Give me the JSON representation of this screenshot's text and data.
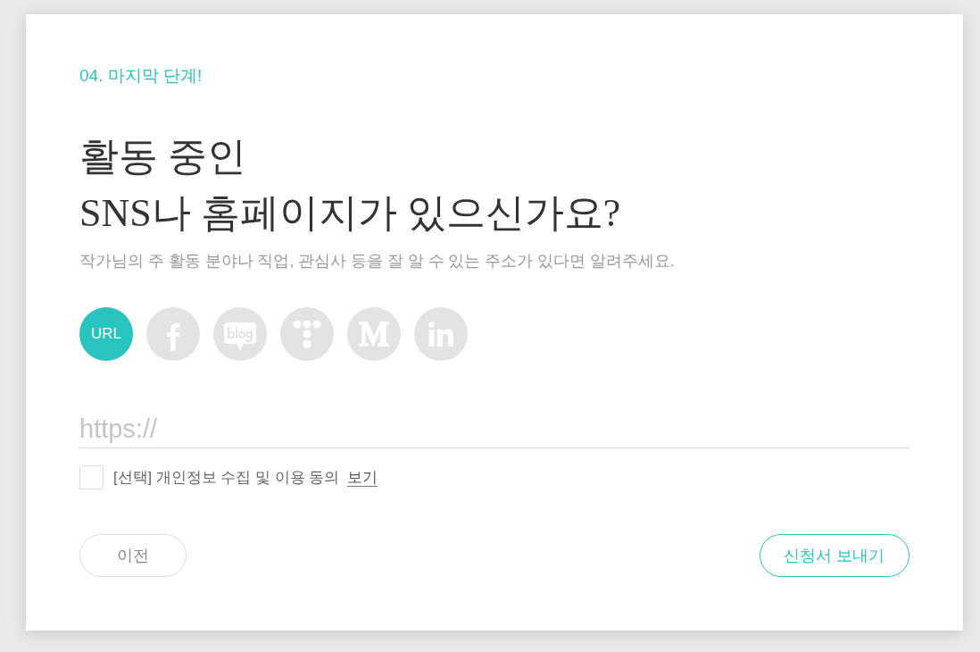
{
  "step_label": "04. 마지막 단계!",
  "title": "활동 중인\nSNS나 홈페이지가 있으신가요?",
  "subtitle": "작가님의 주 활동 분야나 직업, 관심사 등을 잘 알 수 있는 주소가 있다면 알려주세요.",
  "social_options": [
    {
      "kind": "url",
      "label": "URL",
      "selected": true
    },
    {
      "kind": "facebook",
      "selected": false
    },
    {
      "kind": "blog",
      "selected": false
    },
    {
      "kind": "dots",
      "selected": false
    },
    {
      "kind": "medium",
      "selected": false
    },
    {
      "kind": "linkedin",
      "selected": false
    }
  ],
  "url_input": {
    "placeholder": "https://"
  },
  "consent": {
    "label": "[선택] 개인정보 수집 및 이용 동의",
    "link": "보기",
    "checked": false
  },
  "buttons": [
    {
      "kind": "secondary",
      "label": "이전"
    },
    {
      "kind": "primary",
      "label": "신청서 보내기"
    }
  ]
}
